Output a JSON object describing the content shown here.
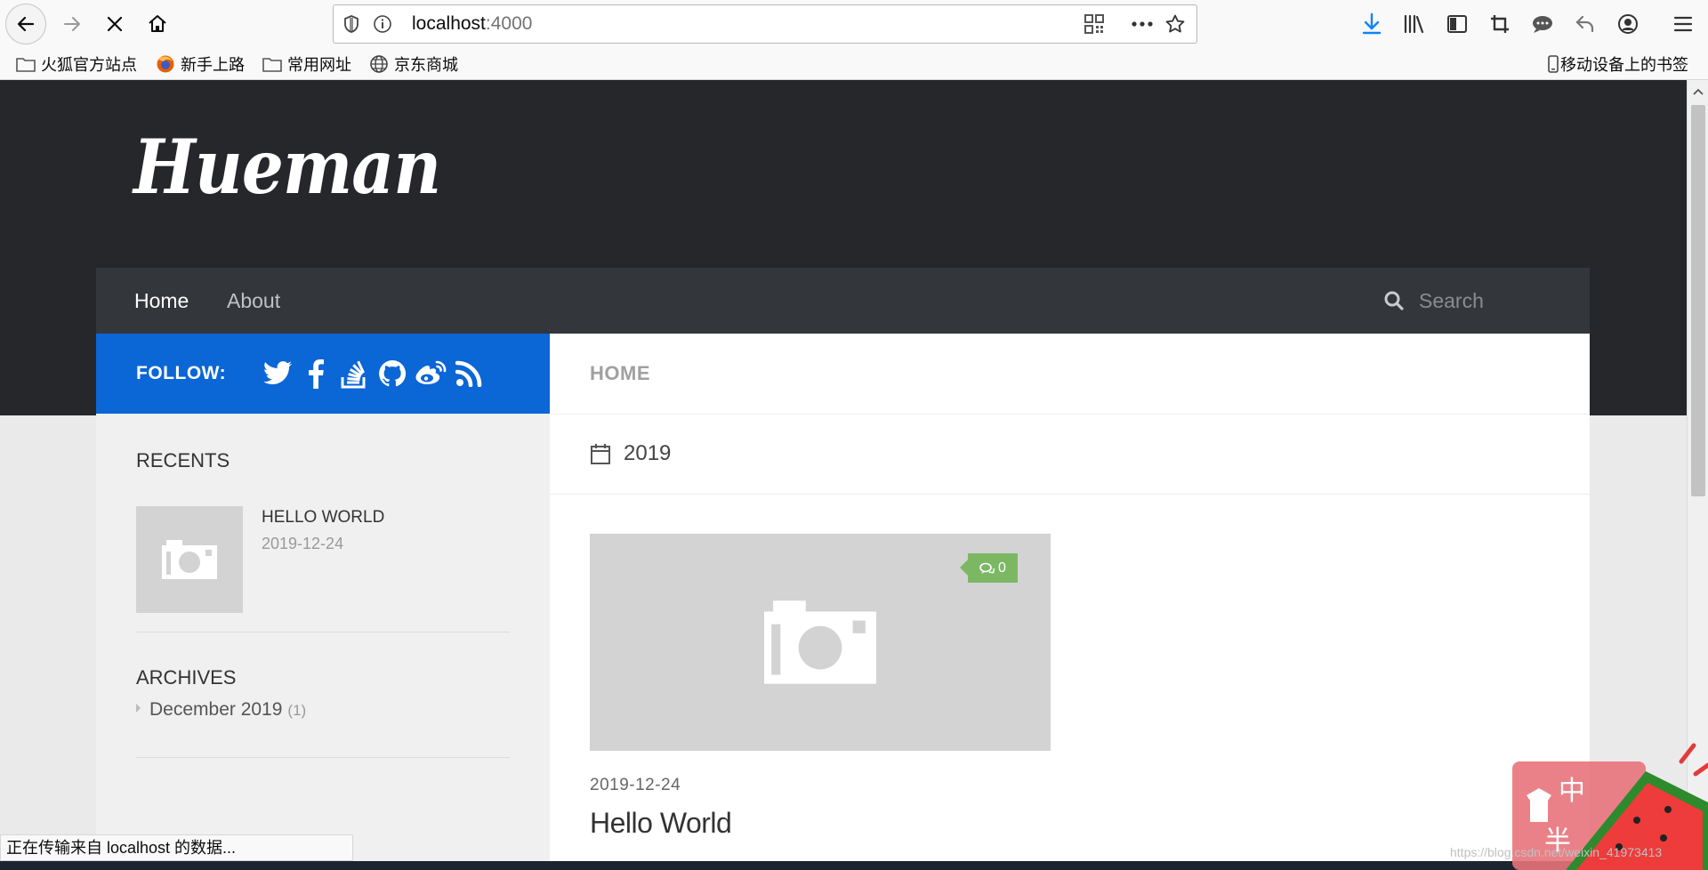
{
  "browser": {
    "url_host": "localhost",
    "url_port": ":4000",
    "bookmarks": [
      "火狐官方站点",
      "新手上路",
      "常用网址",
      "京东商城"
    ],
    "mobile_bookmarks": "移动设备上的书签",
    "status": "正在传输来自 localhost 的数据..."
  },
  "site": {
    "logo": "Hueman",
    "nav": {
      "home": "Home",
      "about": "About",
      "search_placeholder": "Search"
    },
    "follow_label": "FOLLOW:",
    "social_icons": [
      "twitter-icon",
      "facebook-icon",
      "stackoverflow-icon",
      "github-icon",
      "weibo-icon",
      "rss-icon"
    ]
  },
  "sidebar": {
    "recents_title": "RECENTS",
    "recent_post": {
      "title": "HELLO WORLD",
      "date": "2019-12-24"
    },
    "archives_title": "ARCHIVES",
    "archive": {
      "label": "December 2019",
      "count": "(1)"
    }
  },
  "main": {
    "page_title": "HOME",
    "archive_year": "2019",
    "post": {
      "comments": "0",
      "date": "2019-12-24",
      "title": "Hello World"
    }
  },
  "overlay": {
    "watermark": "https://blog.csdn.net/weixin_41973413",
    "widget_chars": [
      "中",
      "半"
    ]
  },
  "colors": {
    "header_bg": "#26272b",
    "nav_bg": "#33363b",
    "follow_bg": "#0b66d6",
    "badge_green": "#7cb864"
  }
}
